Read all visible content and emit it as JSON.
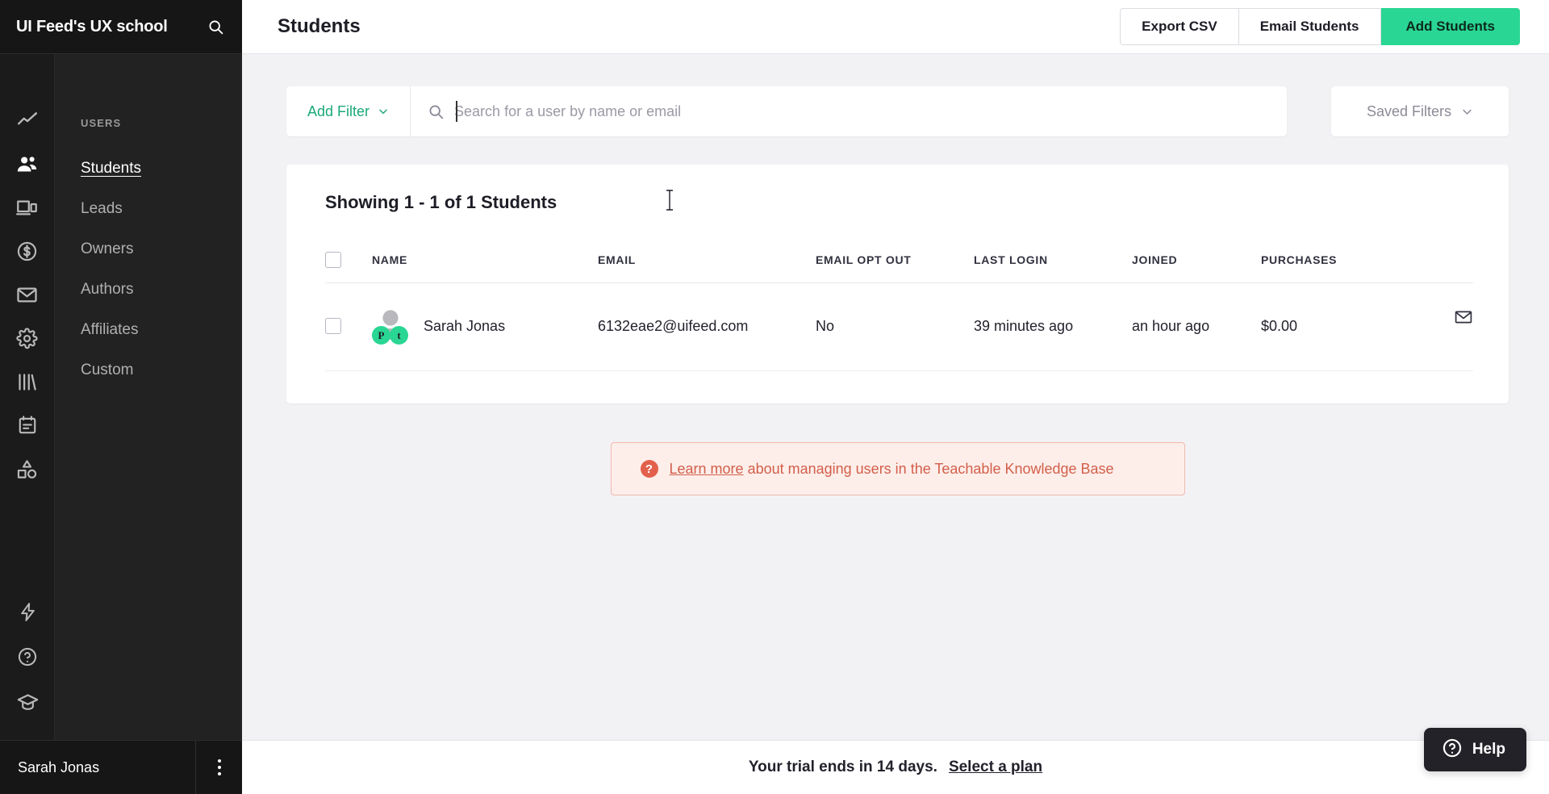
{
  "brand": {
    "title": "UI Feed's UX school",
    "search_icon": "search-icon"
  },
  "rail": {
    "icons": [
      {
        "name": "analytics-icon",
        "title": "Analytics"
      },
      {
        "name": "users-icon",
        "title": "Users"
      },
      {
        "name": "site-icon",
        "title": "Site"
      },
      {
        "name": "sales-icon",
        "title": "Sales"
      },
      {
        "name": "email-icon",
        "title": "Emails"
      },
      {
        "name": "settings-icon",
        "title": "Settings"
      },
      {
        "name": "library-icon",
        "title": "Library"
      },
      {
        "name": "calendar-icon",
        "title": "Calendar"
      },
      {
        "name": "shapes-icon",
        "title": "Design"
      }
    ],
    "bottom_icons": [
      {
        "name": "lightning-icon",
        "title": "Upgrades"
      },
      {
        "name": "question-circle-icon",
        "title": "Support"
      },
      {
        "name": "graduation-cap-icon",
        "title": "Teach"
      }
    ]
  },
  "sidebar": {
    "section_label": "USERS",
    "items": [
      {
        "label": "Students",
        "active": true
      },
      {
        "label": "Leads",
        "active": false
      },
      {
        "label": "Owners",
        "active": false
      },
      {
        "label": "Authors",
        "active": false
      },
      {
        "label": "Affiliates",
        "active": false
      },
      {
        "label": "Custom",
        "active": false
      }
    ],
    "user": {
      "name": "Sarah Jonas",
      "menu_icon": "kebab-menu-icon"
    }
  },
  "topbar": {
    "title": "Students",
    "export_label": "Export CSV",
    "email_label": "Email Students",
    "add_label": "Add Students"
  },
  "filters": {
    "add_filter_label": "Add Filter",
    "add_filter_chevron": "chevron-down-icon",
    "search_placeholder": "Search for a user by name or email",
    "search_value": "",
    "search_icon": "search-icon",
    "saved_filters_label": "Saved Filters",
    "saved_filters_chevron": "chevron-down-icon"
  },
  "table": {
    "caption": "Showing 1 - 1 of 1 Students",
    "columns": [
      "NAME",
      "EMAIL",
      "EMAIL OPT OUT",
      "LAST LOGIN",
      "JOINED",
      "PURCHASES"
    ],
    "rows": [
      {
        "name": "Sarah Jonas",
        "email": "6132eae2@uifeed.com",
        "email_opt_out": "No",
        "last_login": "39 minutes ago",
        "joined": "an hour ago",
        "purchases": "$0.00",
        "avatar": {
          "badge_1": "P",
          "badge_2": "t"
        },
        "action_icon": "envelope-icon"
      }
    ]
  },
  "notice": {
    "icon": "question-circle-icon",
    "link_text": "Learn more",
    "text": " about managing users in the Teachable Knowledge Base"
  },
  "footer": {
    "trial_text": "Your trial ends in 14 days.",
    "plan_link": "Select a plan"
  },
  "help": {
    "label": "Help",
    "icon": "question-circle-icon"
  },
  "colors": {
    "accent_green": "#2ad693",
    "link_green": "#1aa97a",
    "notice_red": "#d35f4a",
    "notice_bg": "#fdeeea",
    "sidebar_dark": "#212121",
    "rail_dark": "#1b1b1b",
    "canvas": "#f2f2f5"
  }
}
